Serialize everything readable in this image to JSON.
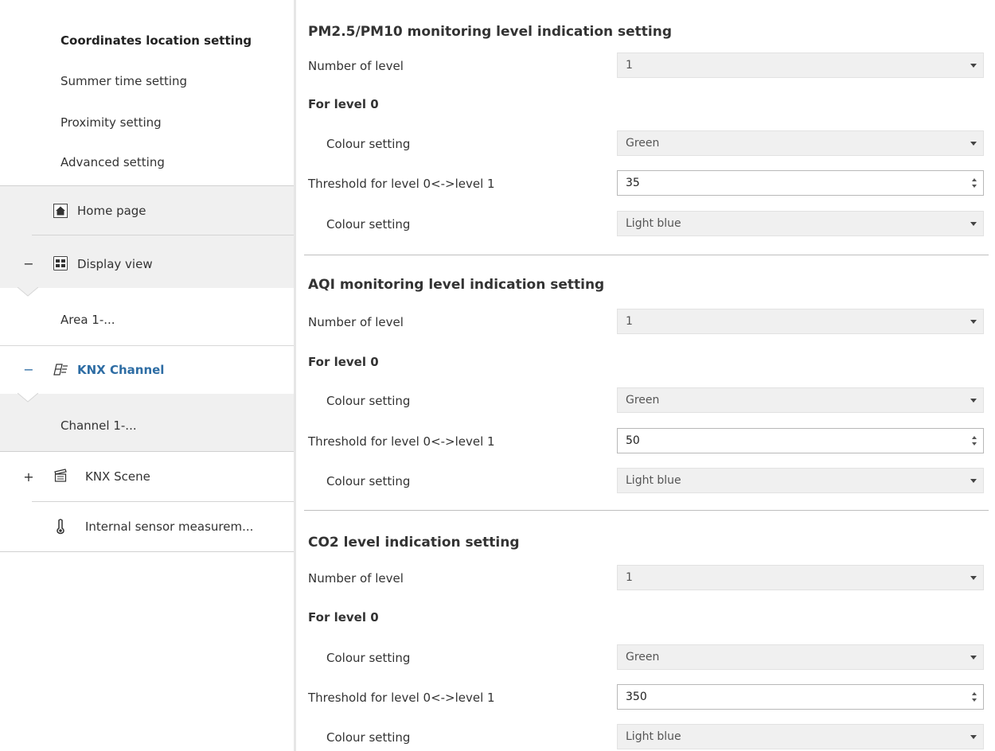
{
  "sidebar": {
    "items": [
      {
        "label": "Coordinates location setting"
      },
      {
        "label": "Summer time setting"
      },
      {
        "label": "Proximity setting"
      },
      {
        "label": "Advanced setting"
      },
      {
        "label": "Home page",
        "icon": "home-icon"
      },
      {
        "label": "Display view",
        "icon": "display-view-icon",
        "toggle": "−"
      },
      {
        "label": "Area 1-..."
      },
      {
        "label": "KNX Channel",
        "icon": "knx-channel-icon",
        "toggle": "−"
      },
      {
        "label": "Channel 1-..."
      },
      {
        "label": "KNX Scene",
        "icon": "scene-clapper-icon",
        "toggle": "+"
      },
      {
        "label": "Internal sensor measurem...",
        "icon": "thermometer-icon"
      }
    ]
  },
  "sections": [
    {
      "title": "PM2.5/PM10 monitoring level indication setting",
      "number_of_level_label": "Number of level",
      "number_of_level_value": "1",
      "for_level_label": "For level 0",
      "colour_label_1": "Colour setting",
      "colour_value_1": "Green",
      "threshold_label": "Threshold for level 0<->level 1",
      "threshold_value": "35",
      "colour_label_2": "Colour setting",
      "colour_value_2": "Light blue"
    },
    {
      "title": "AQI monitoring level indication setting",
      "number_of_level_label": "Number of level",
      "number_of_level_value": "1",
      "for_level_label": "For level 0",
      "colour_label_1": "Colour setting",
      "colour_value_1": "Green",
      "threshold_label": "Threshold for level 0<->level 1",
      "threshold_value": "50",
      "colour_label_2": "Colour setting",
      "colour_value_2": "Light blue"
    },
    {
      "title": "CO2 level indication setting",
      "number_of_level_label": "Number of level",
      "number_of_level_value": "1",
      "for_level_label": "For level 0",
      "colour_label_1": "Colour setting",
      "colour_value_1": "Green",
      "threshold_label": "Threshold for level 0<->level 1",
      "threshold_value": "350",
      "colour_label_2": "Colour setting",
      "colour_value_2": "Light blue"
    }
  ],
  "colors": {
    "sidebar_bg": "#f0f0f0",
    "active_item_text": "#2e6da4",
    "select_bg": "#f0f0f0",
    "divider": "#bfbfbf"
  }
}
